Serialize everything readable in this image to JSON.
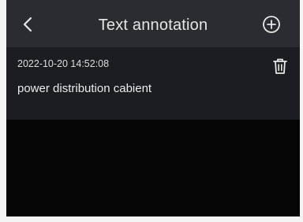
{
  "header": {
    "title": "Text annotation",
    "back_icon": "chevron-left-icon",
    "add_icon": "plus-circle-icon"
  },
  "annotations": [
    {
      "date": "2022-10-20 14:52:08",
      "text": "power distribution cabient",
      "delete_icon": "trash-icon"
    }
  ],
  "colors": {
    "header_bg": "#2b2c31",
    "item_bg": "#1c1d22",
    "screen_bg": "#050505",
    "text": "#e6e6e6"
  }
}
